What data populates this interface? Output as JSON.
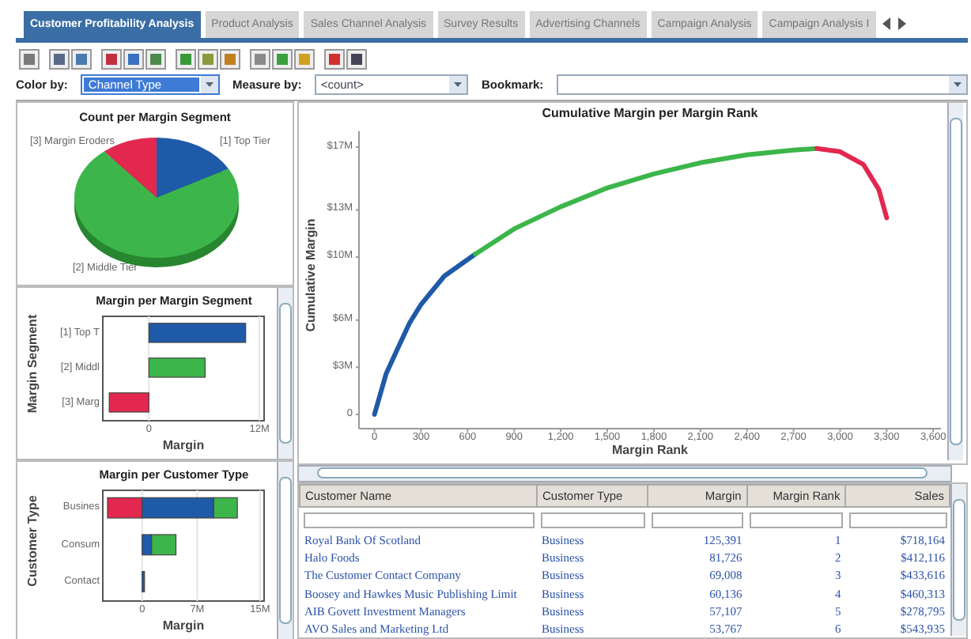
{
  "tabs": [
    {
      "label": "Customer Profitability Analysis",
      "selected": true
    },
    {
      "label": "Product Analysis",
      "selected": false
    },
    {
      "label": "Sales Channel Analysis",
      "selected": false
    },
    {
      "label": "Survey Results",
      "selected": false
    },
    {
      "label": "Advertising Channels",
      "selected": false
    },
    {
      "label": "Campaign Analysis",
      "selected": false
    },
    {
      "label": "Campaign Analysis I",
      "selected": false
    }
  ],
  "filters": [
    {
      "label": "Color by:",
      "value": "Channel Type",
      "highlighted": true
    },
    {
      "label": "Measure by:",
      "value": "<count>",
      "highlighted": false
    },
    {
      "label": "Bookmark:",
      "highlighted": false
    }
  ],
  "pie": {
    "title": "Count per Margin Segment",
    "slices": [
      {
        "label": "[3] Margin Eroders",
        "color": "#e2284f"
      },
      {
        "label": "[1] Top Tier",
        "color": "#1f5aa8"
      },
      {
        "label": "[2] Middle Tier",
        "color": "#3cb64a"
      }
    ]
  },
  "segment_chart": {
    "chart_data": {
      "type": "bar",
      "orientation": "horizontal",
      "stacked": true,
      "title": "Margin per Margin Segment",
      "xlabel": "Margin",
      "ylabel": "Margin Segment",
      "categories": [
        "[1] Top T",
        "[2] Middl",
        "[3] Marg"
      ],
      "series": [
        {
          "color": "#1f5aa8",
          "values": [
            10500000,
            null,
            null
          ]
        },
        {
          "color": "#3cb64a",
          "values": [
            null,
            6100000,
            null
          ]
        },
        {
          "color": "#e2284f",
          "values": [
            null,
            null,
            -4300000
          ]
        }
      ],
      "xlim": [
        -5000000,
        12500000
      ],
      "xticks": [
        {
          "value": 0,
          "label": "0"
        },
        {
          "value": 12000000,
          "label": "12M"
        }
      ]
    }
  },
  "type_chart": {
    "chart_data": {
      "type": "bar",
      "orientation": "horizontal",
      "stacked": true,
      "title": "Margin per Customer Type",
      "xlabel": "Margin",
      "ylabel": "Customer Type",
      "categories": [
        "Busines",
        "Consum",
        "Contact"
      ],
      "series": [
        {
          "color": "#e2284f",
          "values": [
            -4400000,
            0,
            0
          ]
        },
        {
          "color": "#1f5aa8",
          "values": [
            9100000,
            1200000,
            300000
          ]
        },
        {
          "color": "#3cb64a",
          "values": [
            3000000,
            3100000,
            0
          ]
        }
      ],
      "xlim": [
        -5000000,
        15500000
      ],
      "xticks": [
        {
          "value": 0,
          "label": "0"
        },
        {
          "value": 7000000,
          "label": "7M"
        },
        {
          "value": 15000000,
          "label": "15M"
        }
      ]
    }
  },
  "line_chart": {
    "chart_data": {
      "type": "line",
      "title": "Cumulative Margin per Margin Rank",
      "xlabel": "Margin Rank",
      "ylabel": "Cumulative Margin",
      "x": [
        0,
        75,
        150,
        225,
        300,
        450,
        650,
        900,
        1200,
        1500,
        1800,
        2100,
        2400,
        2700,
        2850,
        3000,
        3150,
        3250,
        3300
      ],
      "series": [
        {
          "color": "#1f5aa8",
          "values": [
            0,
            2600000,
            4200000,
            5800000,
            7000000,
            8800000,
            10200000,
            null,
            null,
            null,
            null,
            null,
            null,
            null,
            null,
            null,
            null,
            null,
            null
          ]
        },
        {
          "color": "#3cb64a",
          "values": [
            null,
            null,
            null,
            null,
            null,
            null,
            10200000,
            11800000,
            13200000,
            14400000,
            15300000,
            16000000,
            16500000,
            16800000,
            16900000,
            null,
            null,
            null,
            null
          ]
        },
        {
          "color": "#e2284f",
          "values": [
            null,
            null,
            null,
            null,
            null,
            null,
            null,
            null,
            null,
            null,
            null,
            null,
            null,
            null,
            16900000,
            16700000,
            15900000,
            14300000,
            12500000
          ]
        }
      ],
      "xlim": [
        -100,
        3650
      ],
      "ylim": [
        -900000,
        18000000
      ],
      "xticks": [
        {
          "value": 0,
          "label": "0"
        },
        {
          "value": 300,
          "label": "300"
        },
        {
          "value": 600,
          "label": "600"
        },
        {
          "value": 900,
          "label": "900"
        },
        {
          "value": 1200,
          "label": "1,200"
        },
        {
          "value": 1500,
          "label": "1,500"
        },
        {
          "value": 1800,
          "label": "1,800"
        },
        {
          "value": 2100,
          "label": "2,100"
        },
        {
          "value": 2400,
          "label": "2,400"
        },
        {
          "value": 2700,
          "label": "2,700"
        },
        {
          "value": 3000,
          "label": "3,000"
        },
        {
          "value": 3300,
          "label": "3,300"
        },
        {
          "value": 3600,
          "label": "3,600"
        }
      ],
      "yticks": [
        {
          "value": 0,
          "label": "0"
        },
        {
          "value": 3000000,
          "label": "$3M"
        },
        {
          "value": 6000000,
          "label": "$6M"
        },
        {
          "value": 10000000,
          "label": "$10M"
        },
        {
          "value": 13000000,
          "label": "$13M"
        },
        {
          "value": 17000000,
          "label": "$17M"
        }
      ]
    }
  },
  "table": {
    "columns": [
      {
        "label": "Customer Name",
        "numeric": false
      },
      {
        "label": "Customer Type",
        "numeric": false
      },
      {
        "label": "Margin",
        "numeric": true
      },
      {
        "label": "Margin Rank",
        "numeric": true
      },
      {
        "label": "Sales",
        "numeric": true
      }
    ],
    "rows": [
      [
        "Royal Bank Of Scotland",
        "Business",
        "125,391",
        "1",
        "$718,164"
      ],
      [
        "Halo Foods",
        "Business",
        "81,726",
        "2",
        "$412,116"
      ],
      [
        "The Customer Contact Company",
        "Business",
        "69,008",
        "3",
        "$433,616"
      ],
      [
        "Boosey and Hawkes Music Publishing Limit",
        "Business",
        "60,136",
        "4",
        "$460,313"
      ],
      [
        "AIB Govett Investment Managers",
        "Business",
        "57,107",
        "5",
        "$278,795"
      ],
      [
        "AVO Sales and Marketing Ltd",
        "Business",
        "53,767",
        "6",
        "$543,935"
      ]
    ]
  }
}
